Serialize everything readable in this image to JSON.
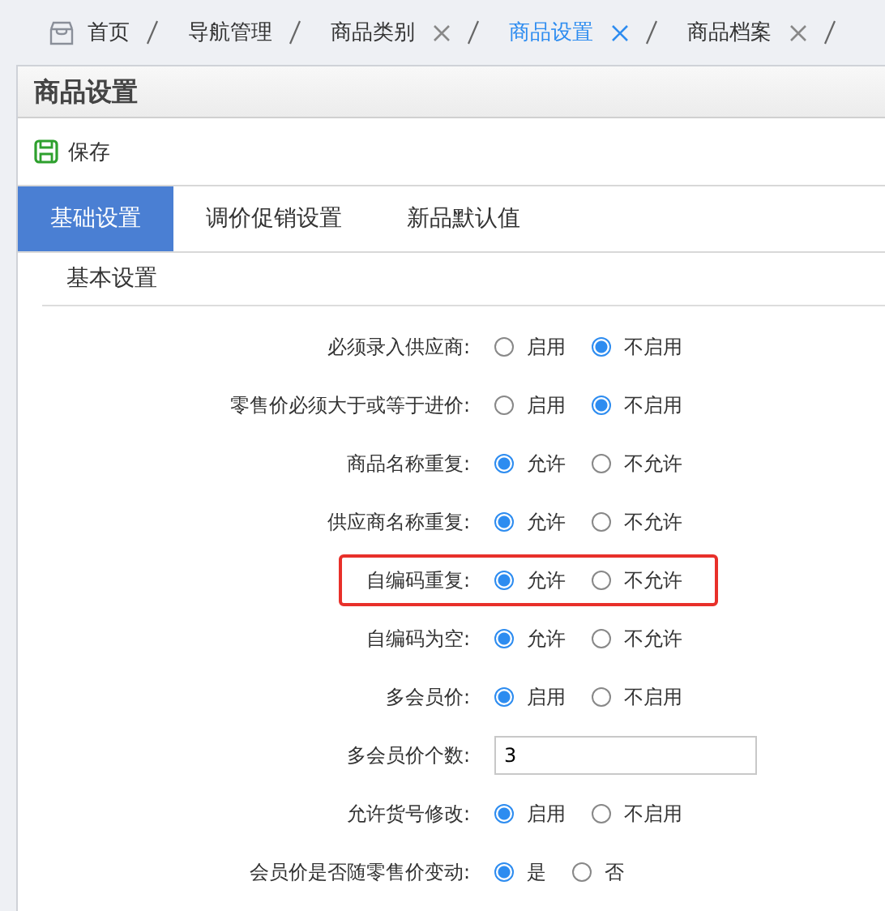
{
  "breadcrumbs": [
    {
      "label": "首页",
      "selected": false,
      "closable": false,
      "home": true
    },
    {
      "label": "导航管理",
      "selected": false,
      "closable": false,
      "home": false
    },
    {
      "label": "商品类别",
      "selected": false,
      "closable": true,
      "home": false
    },
    {
      "label": "商品设置",
      "selected": true,
      "closable": true,
      "home": false
    },
    {
      "label": "商品档案",
      "selected": false,
      "closable": true,
      "home": false
    }
  ],
  "panel": {
    "title": "商品设置",
    "toolbar": [
      {
        "label": "保存"
      }
    ]
  },
  "tabs": [
    {
      "label": "基础设置",
      "selected": true
    },
    {
      "label": "调价促销设置",
      "selected": false
    },
    {
      "label": "新品默认值",
      "selected": false
    }
  ],
  "section": {
    "title": "基本设置"
  },
  "fields": [
    {
      "kind": "radio",
      "label": "必须录入供应商:",
      "highlighted": false,
      "options": [
        {
          "label": "启用",
          "selected": false
        },
        {
          "label": "不启用",
          "selected": true
        }
      ]
    },
    {
      "kind": "radio",
      "label": "零售价必须大于或等于进价:",
      "highlighted": false,
      "options": [
        {
          "label": "启用",
          "selected": false
        },
        {
          "label": "不启用",
          "selected": true
        }
      ]
    },
    {
      "kind": "radio",
      "label": "商品名称重复:",
      "highlighted": false,
      "options": [
        {
          "label": "允许",
          "selected": true
        },
        {
          "label": "不允许",
          "selected": false
        }
      ]
    },
    {
      "kind": "radio",
      "label": "供应商名称重复:",
      "highlighted": false,
      "options": [
        {
          "label": "允许",
          "selected": true
        },
        {
          "label": "不允许",
          "selected": false
        }
      ]
    },
    {
      "kind": "radio",
      "label": "自编码重复:",
      "highlighted": true,
      "options": [
        {
          "label": "允许",
          "selected": true
        },
        {
          "label": "不允许",
          "selected": false
        }
      ]
    },
    {
      "kind": "radio",
      "label": "自编码为空:",
      "highlighted": false,
      "options": [
        {
          "label": "允许",
          "selected": true
        },
        {
          "label": "不允许",
          "selected": false
        }
      ]
    },
    {
      "kind": "radio",
      "label": "多会员价:",
      "highlighted": false,
      "options": [
        {
          "label": "启用",
          "selected": true
        },
        {
          "label": "不启用",
          "selected": false
        }
      ]
    },
    {
      "kind": "input",
      "label": "多会员价个数:",
      "highlighted": false,
      "value": "3"
    },
    {
      "kind": "radio",
      "label": "允许货号修改:",
      "highlighted": false,
      "options": [
        {
          "label": "启用",
          "selected": true
        },
        {
          "label": "不启用",
          "selected": false
        }
      ]
    },
    {
      "kind": "radio",
      "label": "会员价是否随零售价变动:",
      "highlighted": false,
      "options": [
        {
          "label": "是",
          "selected": true
        },
        {
          "label": "否",
          "selected": false
        }
      ]
    }
  ]
}
